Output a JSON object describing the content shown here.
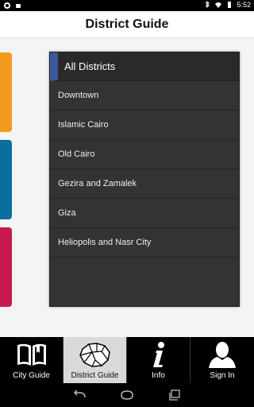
{
  "statusbar": {
    "time": "5:52"
  },
  "titlebar": {
    "title": "District Guide"
  },
  "panel": {
    "header": "All Districts",
    "items": [
      "Downtown",
      "Islamic Cairo",
      "Old Cairo",
      "Gezira and Zamalek",
      "Giza",
      "Heliopolis and Nasr City"
    ]
  },
  "tabs": [
    {
      "label": "City Guide",
      "icon": "book-icon"
    },
    {
      "label": "District Guide",
      "icon": "district-map-icon"
    },
    {
      "label": "Info",
      "icon": "info-icon"
    },
    {
      "label": "Sign In",
      "icon": "person-icon"
    }
  ],
  "colors": {
    "tile_orange": "#f39a1d",
    "tile_blue": "#0b6e9c",
    "tile_red": "#c8184d",
    "panel_accent": "#3a5a9a"
  }
}
